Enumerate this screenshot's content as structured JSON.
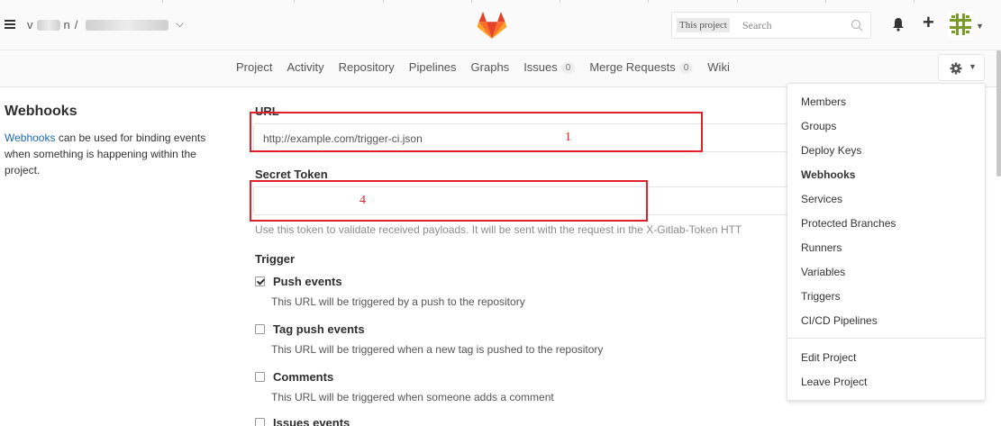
{
  "header": {
    "breadcrumb_sep": "/",
    "search_scope": "This project",
    "search_placeholder": "Search"
  },
  "nav": {
    "items": [
      {
        "label": "Project"
      },
      {
        "label": "Activity"
      },
      {
        "label": "Repository"
      },
      {
        "label": "Pipelines"
      },
      {
        "label": "Graphs"
      },
      {
        "label": "Issues",
        "badge": "0"
      },
      {
        "label": "Merge Requests",
        "badge": "0"
      },
      {
        "label": "Wiki"
      }
    ]
  },
  "sidebar": {
    "title": "Webhooks",
    "desc_link": "Webhooks",
    "desc_rest": " can be used for binding events when something is happening within the project."
  },
  "form": {
    "url_label": "URL",
    "url_value": "http://example.com/trigger-ci.json",
    "secret_label": "Secret Token",
    "secret_value": "",
    "help_text": "Use this token to validate received payloads. It will be sent with the request in the X-Gitlab-Token HTT",
    "trigger_label": "Trigger",
    "triggers": [
      {
        "title": "Push events",
        "desc": "This URL will be triggered by a push to the repository",
        "checked": true
      },
      {
        "title": "Tag push events",
        "desc": "This URL will be triggered when a new tag is pushed to the repository",
        "checked": false
      },
      {
        "title": "Comments",
        "desc": "This URL will be triggered when someone adds a comment",
        "checked": false
      },
      {
        "title": "Issues events",
        "desc": "",
        "checked": false
      }
    ]
  },
  "annotations": {
    "url_mark": "1",
    "token_mark": "4",
    "color": "#e0202a"
  },
  "dropdown": {
    "items": [
      "Members",
      "Groups",
      "Deploy Keys",
      "Webhooks",
      "Services",
      "Protected Branches",
      "Runners",
      "Variables",
      "Triggers",
      "CI/CD Pipelines"
    ],
    "active": "Webhooks",
    "footer_items": [
      "Edit Project",
      "Leave Project"
    ]
  },
  "colors": {
    "link": "#1b69b6",
    "logo_orange": "#fc6d26",
    "logo_red": "#e24329",
    "logo_light": "#fca326"
  }
}
